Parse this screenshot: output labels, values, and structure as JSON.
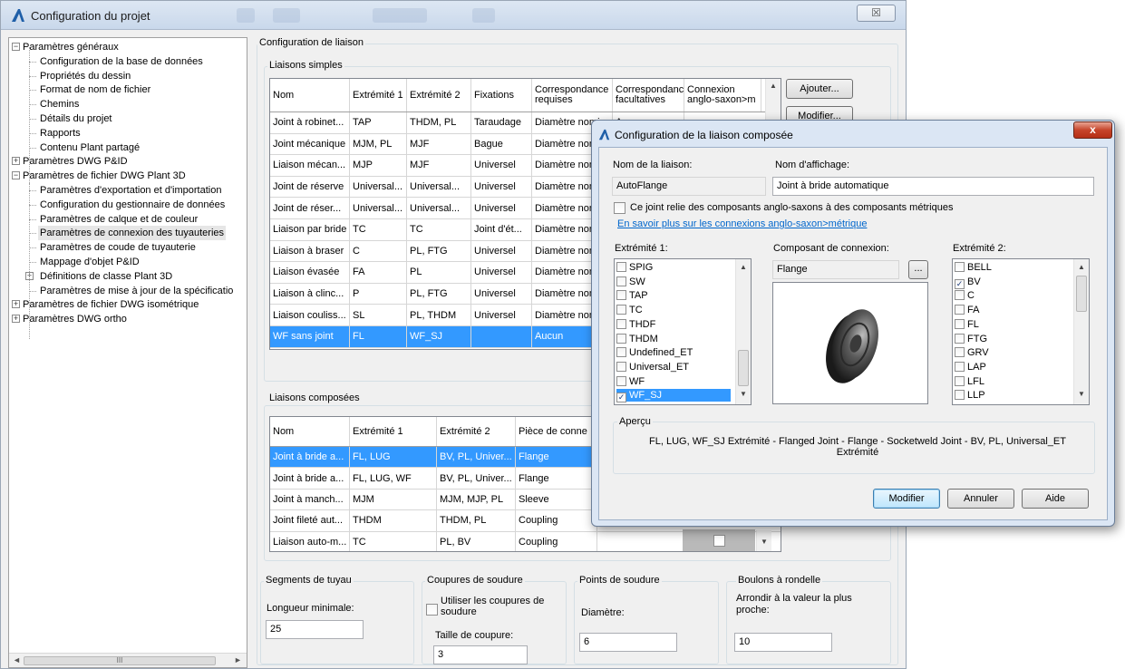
{
  "main_window": {
    "title": "Configuration du projet",
    "close_label": "☒"
  },
  "tree": {
    "items": [
      {
        "label": "Paramètres généraux",
        "level": 0,
        "expander": "−"
      },
      {
        "label": "Configuration de la base de données",
        "level": 1
      },
      {
        "label": "Propriétés du dessin",
        "level": 1
      },
      {
        "label": "Format de nom de fichier",
        "level": 1
      },
      {
        "label": "Chemins",
        "level": 1
      },
      {
        "label": "Détails du projet",
        "level": 1
      },
      {
        "label": "Rapports",
        "level": 1
      },
      {
        "label": "Contenu Plant partagé",
        "level": 1
      },
      {
        "label": "Paramètres DWG P&ID",
        "level": 0,
        "expander": "+"
      },
      {
        "label": "Paramètres de fichier DWG Plant 3D",
        "level": 0,
        "expander": "−"
      },
      {
        "label": "Paramètres d'exportation et d'importation",
        "level": 1
      },
      {
        "label": "Configuration du gestionnaire de données",
        "level": 1
      },
      {
        "label": "Paramètres de calque et de couleur",
        "level": 1
      },
      {
        "label": "Paramètres de connexion des tuyauteries",
        "level": 1,
        "selected": true
      },
      {
        "label": "Paramètres de coude de tuyauterie",
        "level": 1
      },
      {
        "label": "Mappage d'objet P&ID",
        "level": 1
      },
      {
        "label": "Définitions de classe Plant 3D",
        "level": 1,
        "expander": "+"
      },
      {
        "label": "Paramètres de mise à jour de la spécificatio",
        "level": 1
      },
      {
        "label": "Paramètres de fichier DWG isométrique",
        "level": 0,
        "expander": "+"
      },
      {
        "label": "Paramètres DWG ortho",
        "level": 0,
        "expander": "+"
      }
    ],
    "hscroll_glyph": "III"
  },
  "config_liaison": {
    "group_label": "Configuration de liaison",
    "simples": {
      "group_label": "Liaisons simples",
      "headers": [
        "Nom",
        "Extrémité 1",
        "Extrémité 2",
        "Fixations",
        "Correspondance requises",
        "Correspondances facultatives",
        "Connexion anglo-saxon>m"
      ],
      "rows": [
        [
          "Joint à robinet...",
          "TAP",
          "THDM, PL",
          "Taraudage",
          "Diamètre nomi",
          "Aucun"
        ],
        [
          "Joint mécanique",
          "MJM, PL",
          "MJF",
          "Bague",
          "Diamètre nom",
          ""
        ],
        [
          "Liaison mécan...",
          "MJP",
          "MJF",
          "Universel",
          "Diamètre nom",
          ""
        ],
        [
          "Joint de réserve",
          "Universal...",
          "Universal...",
          "Universel",
          "Diamètre nom",
          ""
        ],
        [
          "Joint de réser...",
          "Universal...",
          "Universal...",
          "Universel",
          "Diamètre nom",
          ""
        ],
        [
          "Liaison par bride",
          "TC",
          "TC",
          "Joint d'ét...",
          "Diamètre nom",
          ""
        ],
        [
          "Liaison à braser",
          "C",
          "PL, FTG",
          "Universel",
          "Diamètre nom",
          ""
        ],
        [
          "Liaison évasée",
          "FA",
          "PL",
          "Universel",
          "Diamètre nom",
          ""
        ],
        [
          "Liaison à clinc...",
          "P",
          "PL, FTG",
          "Universel",
          "Diamètre nom",
          ""
        ],
        [
          "Liaison couliss...",
          "SL",
          "PL, THDM",
          "Universel",
          "Diamètre nom",
          ""
        ],
        [
          "WF sans joint",
          "FL",
          "WF_SJ",
          "",
          "Aucun",
          ""
        ]
      ],
      "selected_row": 10,
      "buttons": {
        "add": "Ajouter...",
        "modify": "Modifier..."
      }
    },
    "composees": {
      "group_label": "Liaisons composées",
      "headers": [
        "Nom",
        "Extrémité 1",
        "Extrémité 2",
        "Pièce de conne"
      ],
      "rows": [
        [
          "Joint à bride a...",
          "FL, LUG",
          "BV, PL, Univer...",
          "Flange"
        ],
        [
          "Joint à bride a...",
          "FL, LUG, WF",
          "BV, PL, Univer...",
          "Flange"
        ],
        [
          "Joint à manch...",
          "MJM",
          "MJM, MJP, PL",
          "Sleeve"
        ],
        [
          "Joint fileté aut...",
          "THDM",
          "THDM, PL",
          "Coupling"
        ],
        [
          "Liaison auto-m...",
          "TC",
          "PL, BV",
          "Coupling"
        ]
      ],
      "selected_row": 0
    }
  },
  "bottom": {
    "segments": {
      "label": "Segments de tuyau",
      "field_label": "Longueur minimale:",
      "value": "25"
    },
    "coupures": {
      "label": "Coupures de soudure",
      "checkbox_label": "Utiliser les coupures de soudure",
      "size_label": "Taille de coupure:",
      "value": "3"
    },
    "points": {
      "label": "Points de soudure",
      "field_label": "Diamètre:",
      "value": "6"
    },
    "boulons": {
      "label": "Boulons à rondelle",
      "field_label": "Arrondir à la valeur la plus proche:",
      "value": "10"
    }
  },
  "dialog": {
    "title": "Configuration de la liaison composée",
    "close_label": "x",
    "nom_label": "Nom de la liaison:",
    "nom_value": "AutoFlange",
    "affichage_label": "Nom d'affichage:",
    "affichage_value": "Joint à bride automatique",
    "checkbox_label": "Ce joint relie des composants anglo-saxons à des composants métriques",
    "link_label": "En savoir plus sur les connexions anglo-saxon>métrique",
    "extremite1_label": "Extrémité 1:",
    "extremite1_items": [
      {
        "label": "SPIG",
        "checked": false
      },
      {
        "label": "SW",
        "checked": false
      },
      {
        "label": "TAP",
        "checked": false
      },
      {
        "label": "TC",
        "checked": false
      },
      {
        "label": "THDF",
        "checked": false
      },
      {
        "label": "THDM",
        "checked": false
      },
      {
        "label": "Undefined_ET",
        "checked": false
      },
      {
        "label": "Universal_ET",
        "checked": false
      },
      {
        "label": "WF",
        "checked": false
      },
      {
        "label": "WF_SJ",
        "checked": true,
        "selected": true
      }
    ],
    "composant_label": "Composant de connexion:",
    "composant_value": "Flange",
    "browse_label": "...",
    "extremite2_label": "Extrémité 2:",
    "extremite2_items": [
      {
        "label": "BELL",
        "checked": false
      },
      {
        "label": "BV",
        "checked": true
      },
      {
        "label": "C",
        "checked": false
      },
      {
        "label": "FA",
        "checked": false
      },
      {
        "label": "FL",
        "checked": false
      },
      {
        "label": "FTG",
        "checked": false
      },
      {
        "label": "GRV",
        "checked": false
      },
      {
        "label": "LAP",
        "checked": false
      },
      {
        "label": "LFL",
        "checked": false
      },
      {
        "label": "LLP",
        "checked": false
      }
    ],
    "apercu_label": "Aperçu",
    "apercu_text": "FL, LUG, WF_SJ Extrémité - Flanged Joint - Flange - Socketweld Joint - BV, PL, Universal_ET Extrémité",
    "buttons": {
      "modify": "Modifier",
      "cancel": "Annuler",
      "help": "Aide"
    }
  },
  "colors": {
    "selection": "#3399ff",
    "link": "#0066cc",
    "dialog_close": "#c6442a"
  }
}
